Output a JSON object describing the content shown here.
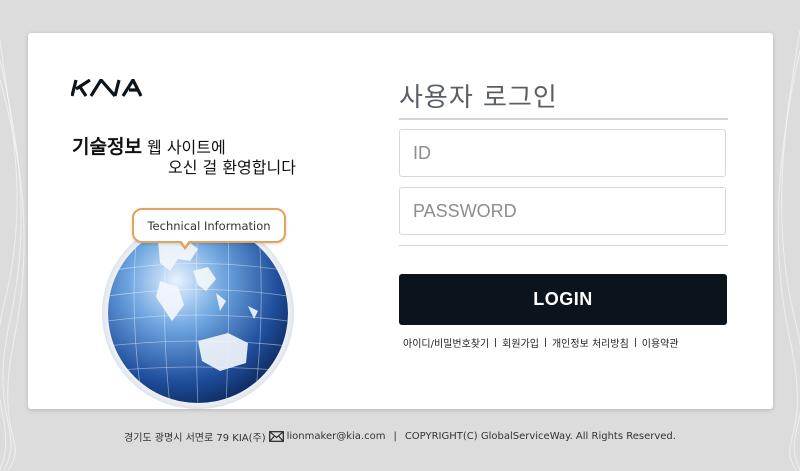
{
  "brand": {
    "logo_text": "KIA"
  },
  "welcome": {
    "strong": "기술정보",
    "line1": " 웹 사이트에",
    "line2": "오신 걸 환영합니다"
  },
  "illustration": {
    "bubble_text": "Technical Information"
  },
  "login": {
    "title": "사용자 로그인",
    "id_placeholder": "ID",
    "password_placeholder": "PASSWORD",
    "button_label": "LOGIN"
  },
  "links": [
    "아이디/비밀번호찾기",
    "회원가입",
    "개인정보 처리방침",
    "이용약관"
  ],
  "footer": {
    "address": "경기도 광명시 서면로 79 KIA(주)",
    "email": "lionmaker@kia.com",
    "separator": "|",
    "copyright": "COPYRIGHT(C) GlobalServiceWay. All Rights Reserved."
  },
  "colors": {
    "background": "#dcdcdc",
    "button": "#0b131c",
    "bubble_border": "#e3a35a",
    "title": "#5a5f66"
  }
}
